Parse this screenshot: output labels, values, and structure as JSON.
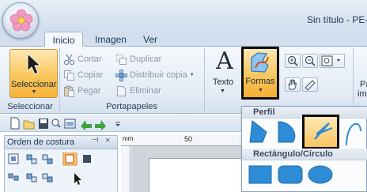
{
  "window": {
    "title": "Sin título - PE-D"
  },
  "tabs": [
    {
      "label": "Inicio",
      "active": true
    },
    {
      "label": "Imagen",
      "active": false
    },
    {
      "label": "Ver",
      "active": false
    }
  ],
  "ribbon": {
    "seleccionar": {
      "label": "Seleccionar",
      "group_label": "Seleccionar"
    },
    "portapapeles": {
      "group_label": "Portapapeles",
      "cortar": "Cortar",
      "copiar": "Copiar",
      "pegar": "Pegar",
      "duplicar": "Duplicar",
      "distribuir": "Distribuir copia",
      "eliminar": "Eliminar"
    },
    "texto": {
      "glyph": "A",
      "label": "Texto"
    },
    "formas": {
      "label": "Formas"
    },
    "cut_off_label_1": "Pa",
    "cut_off_label_2": "im"
  },
  "sidebar": {
    "title": "Orden de costura",
    "pin": "⊣",
    "close": "×"
  },
  "ruler": {
    "unit": "mm",
    "mark_50": "50"
  },
  "shapes_dropdown": {
    "perfil_header": "Perfil",
    "rect_header": "Rectángulo/Círculo"
  },
  "colors": {
    "accent_orange": "#f9c75e",
    "shape_blue": "#2e8bd6",
    "ribbon_bg": "#e3ebf5"
  }
}
